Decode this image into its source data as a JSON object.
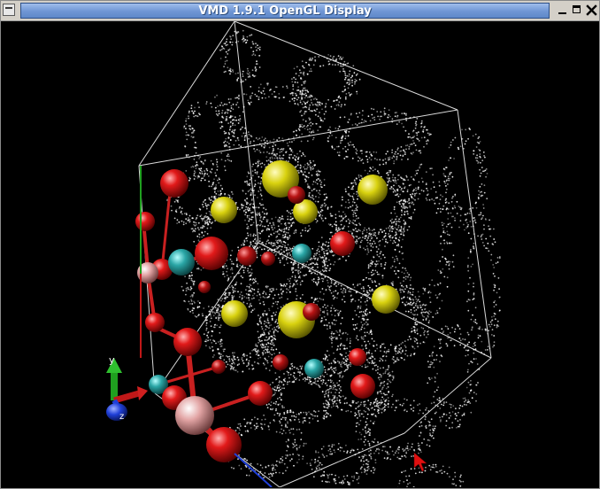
{
  "window": {
    "title": "VMD 1.9.1 OpenGL Display",
    "buttons": {
      "minimize": "minimize-icon",
      "maximize": "maximize-icon",
      "close": "close-icon",
      "menu": "window-menu-icon"
    }
  },
  "axes_indicator": {
    "y_label": "y",
    "z_label": "z",
    "x_color": "#c01818",
    "y_color": "#1fa01f",
    "z_color": "#1f3fd8"
  },
  "atom_colors": {
    "O": "#d81010",
    "S": "#d8d010",
    "N": "#2aa6a6",
    "H": "#e6a7a7"
  },
  "scene": {
    "background": "#000000",
    "surface_color": "#ffffff",
    "cell_color": "#ffffff"
  }
}
